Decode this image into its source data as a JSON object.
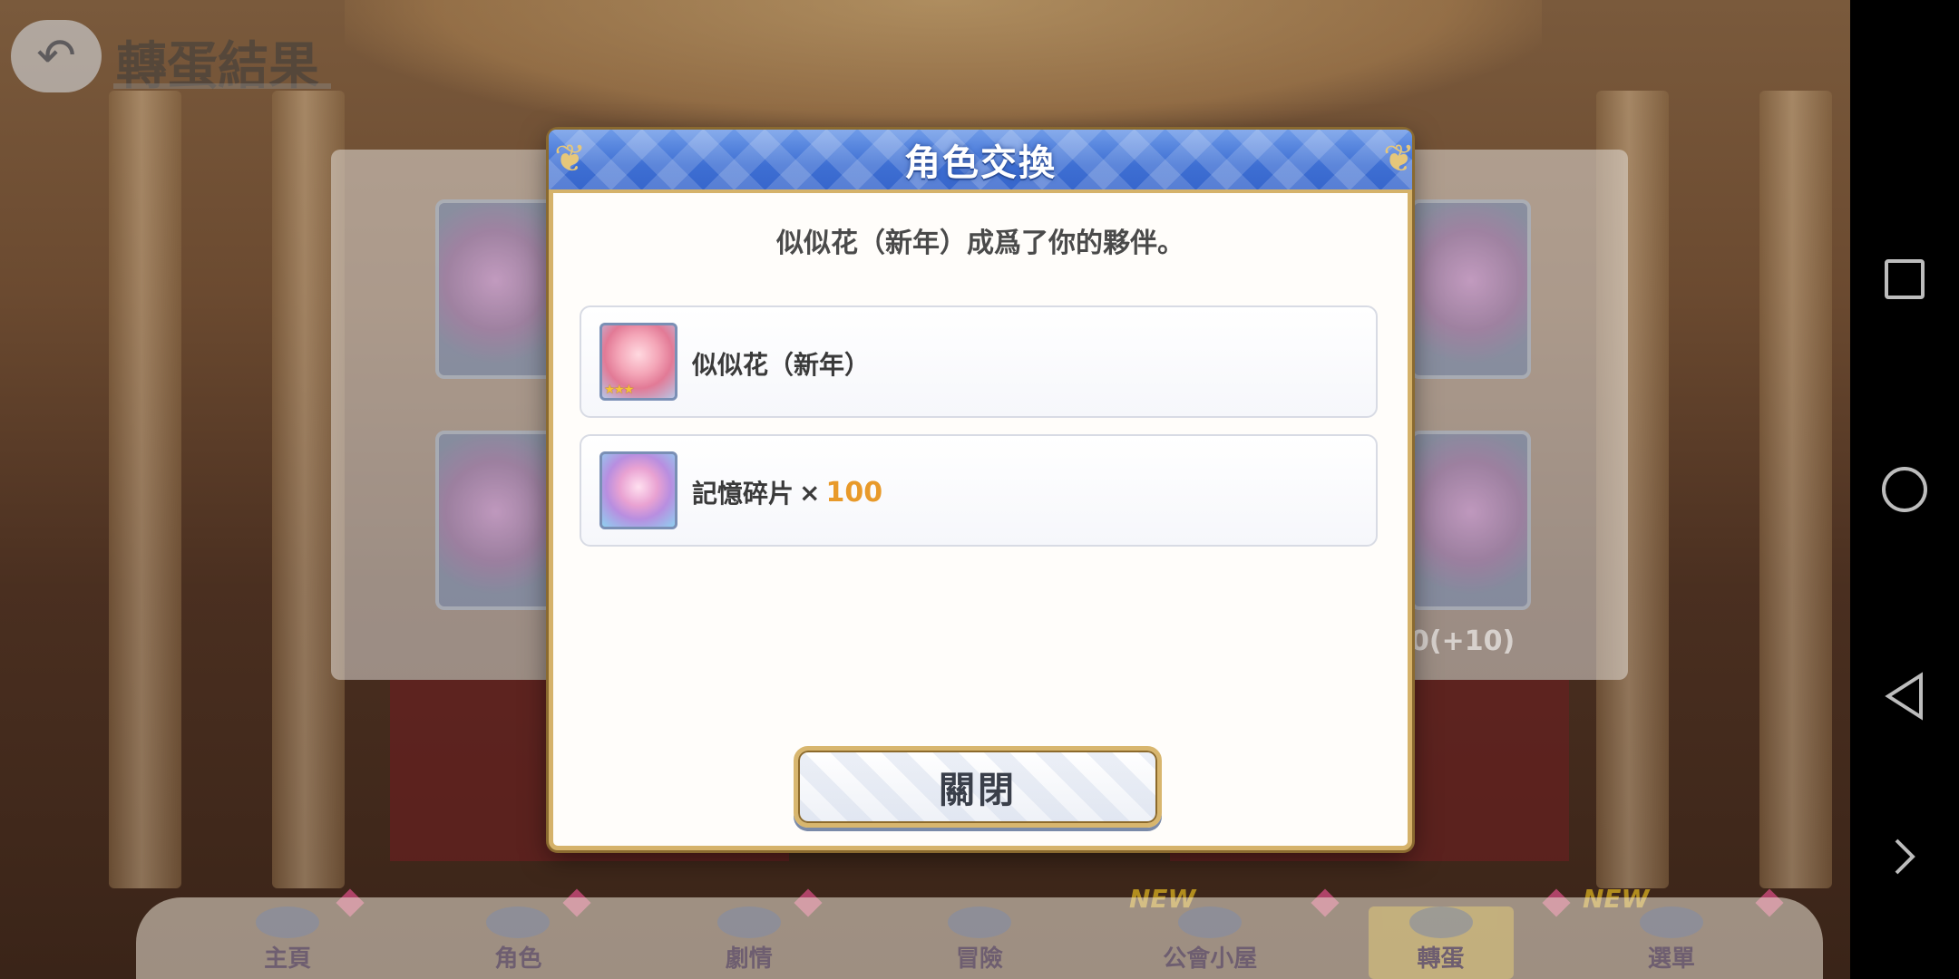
{
  "background": {
    "screen_title": "轉蛋結果",
    "menu": [
      {
        "label": "主頁",
        "new": false
      },
      {
        "label": "角色",
        "new": false
      },
      {
        "label": "劇情",
        "new": false
      },
      {
        "label": "冒險",
        "new": false
      },
      {
        "label": "公會小屋",
        "new": true
      },
      {
        "label": "轉蛋",
        "new": false,
        "active": true
      },
      {
        "label": "選單",
        "new": true
      }
    ],
    "new_tag": "NEW",
    "peek_text": "0(+10)"
  },
  "dialog": {
    "title": "角色交換",
    "message": "似似花（新年）成爲了你的夥伴。",
    "rewards": [
      {
        "name": "似似花（新年）",
        "icon": "character-portrait-icon",
        "stars": "★★★"
      },
      {
        "name": "記憶碎片",
        "times": "×",
        "quantity": "100",
        "icon": "memory-piece-icon"
      }
    ],
    "close_label": "關閉"
  },
  "navbar": {
    "icons": [
      "recent-apps-icon",
      "home-icon",
      "back-icon",
      "expand-icon"
    ]
  },
  "colors": {
    "header_blue": "#3e6fd3",
    "gold_border": "#d5b26a",
    "quantity_orange": "#e89a2a"
  }
}
